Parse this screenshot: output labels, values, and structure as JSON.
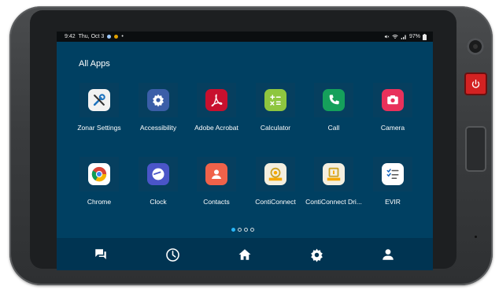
{
  "status_bar": {
    "time": "9:42",
    "date": "Thu, Oct 3",
    "battery": "97%"
  },
  "page_title": "All Apps",
  "apps": [
    {
      "label": "Zonar Settings",
      "icon": "tools-icon",
      "color": "#f2f2f2"
    },
    {
      "label": "Accessibility",
      "icon": "gear-icon",
      "color": "#3b5ea8"
    },
    {
      "label": "Adobe Acrobat",
      "icon": "acrobat-icon",
      "color": "#c8102e"
    },
    {
      "label": "Calculator",
      "icon": "calculator-icon",
      "color": "#8ec63f"
    },
    {
      "label": "Call",
      "icon": "phone-icon",
      "color": "#15a05b"
    },
    {
      "label": "Camera",
      "icon": "camera-icon",
      "color": "#e8315b"
    },
    {
      "label": "Chrome",
      "icon": "chrome-icon",
      "color": "#ffffff"
    },
    {
      "label": "Clock",
      "icon": "clock-icon",
      "color": "#4a55c8"
    },
    {
      "label": "Contacts",
      "icon": "person-icon",
      "color": "#f0624a"
    },
    {
      "label": "ContiConnect",
      "icon": "conticonnect-icon",
      "color": "#f4efe0"
    },
    {
      "label": "ContiConnect Dri...",
      "icon": "conticonnect-driver-icon",
      "color": "#f4efe0"
    },
    {
      "label": "EVIR",
      "icon": "checklist-icon",
      "color": "#ffffff"
    }
  ],
  "page_indicator": {
    "total": 4,
    "active": 1
  },
  "navbar": [
    {
      "name": "messages-icon"
    },
    {
      "name": "clock-icon"
    },
    {
      "name": "home-icon"
    },
    {
      "name": "settings-icon"
    },
    {
      "name": "profile-icon"
    }
  ],
  "colors": {
    "screen_bg": "#004062",
    "tile_bg": "#063f5f",
    "navbar_bg": "#003452",
    "power_button": "#d32222"
  }
}
